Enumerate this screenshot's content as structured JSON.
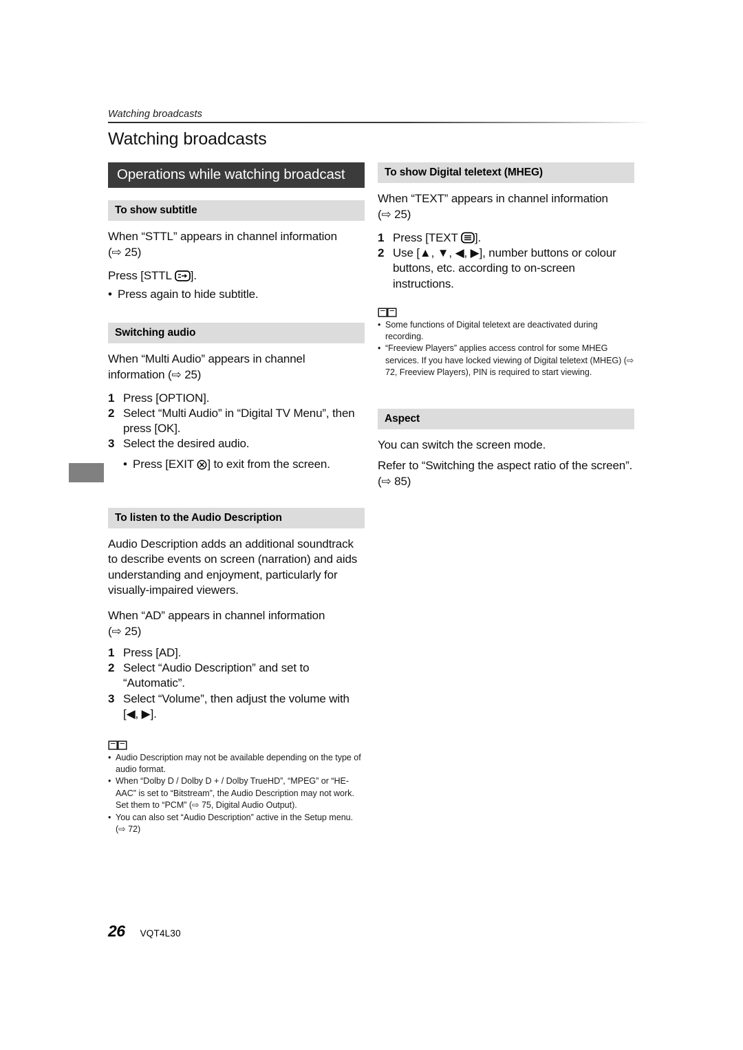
{
  "header": {
    "running_title": "Watching broadcasts"
  },
  "chapter_title": "Watching broadcasts",
  "left_column": {
    "section_banner": "Operations while watching broadcast",
    "subtitle_section": {
      "heading": "To show subtitle",
      "intro_line1": "When “STTL” appears in channel information",
      "intro_ref": "(⇨ 25)",
      "press_line_prefix": "Press [STTL ",
      "press_line_suffix": "].",
      "bullet": "Press again to hide subtitle."
    },
    "switching_audio_section": {
      "heading": "Switching audio",
      "intro_line1": "When “Multi Audio” appears in channel",
      "intro_line2": "information (⇨ 25)",
      "steps": [
        {
          "num": "1",
          "text": "Press [OPTION]."
        },
        {
          "num": "2",
          "text": "Select “Multi Audio” in “Digital TV Menu”, then press [OK]."
        },
        {
          "num": "3",
          "text": "Select the desired audio."
        }
      ],
      "bullet_prefix": "Press [EXIT ",
      "bullet_suffix": "] to exit from the screen."
    },
    "audio_description_section": {
      "heading": "To listen to the Audio Description",
      "paragraph": "Audio Description adds an additional soundtrack to describe events on screen (narration) and aids understanding and enjoyment, particularly for visually-impaired viewers.",
      "intro_line1": "When “AD” appears in channel information",
      "intro_ref": "(⇨ 25)",
      "steps": [
        {
          "num": "1",
          "text": "Press [AD]."
        },
        {
          "num": "2",
          "text": "Select “Audio Description” and set to “Automatic”."
        },
        {
          "num": "3",
          "text": "Select “Volume”, then adjust the volume with [◀, ▶]."
        }
      ],
      "notes": [
        "Audio Description may not be available depending on the type of audio format.",
        "When “Dolby D / Dolby D + / Dolby TrueHD”, “MPEG” or “HE-AAC” is set to “Bitstream”, the Audio Description may not work. Set them to “PCM” (⇨ 75, Digital Audio Output).",
        "You can also set “Audio Description” active in the Setup menu. (⇨ 72)"
      ]
    }
  },
  "right_column": {
    "mheg_section": {
      "heading": "To show Digital teletext (MHEG)",
      "intro_line1": "When “TEXT” appears in channel information",
      "intro_ref": "(⇨ 25)",
      "step1_num": "1",
      "step1_prefix": "Press [TEXT ",
      "step1_suffix": "].",
      "step2_num": "2",
      "step2_text": "Use [▲, ▼, ◀, ▶], number buttons or colour buttons, etc. according to on-screen instructions.",
      "notes": [
        "Some functions of Digital teletext are deactivated during recording.",
        "“Freeview Players” applies access control for some MHEG services. If you have locked viewing of Digital teletext (MHEG) (⇨ 72, Freeview Players), PIN is required to start viewing."
      ]
    },
    "aspect_section": {
      "heading": "Aspect",
      "line1": "You can switch the screen mode.",
      "line2": "Refer to “Switching the aspect ratio of the screen”. (⇨ 85)"
    }
  },
  "footer": {
    "page_number": "26",
    "document_code": "VQT4L30"
  }
}
